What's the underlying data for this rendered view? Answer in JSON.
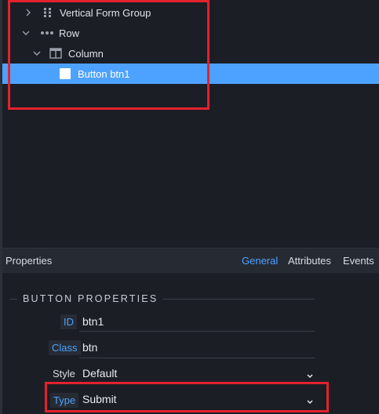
{
  "tree": {
    "items": [
      {
        "label": "Vertical Form Group",
        "icon": "grid-dots-icon",
        "expand": "chevron-right-icon"
      },
      {
        "label": "Row",
        "icon": "horizontal-dots-icon",
        "expand": "chevron-down-icon"
      },
      {
        "label": "Column",
        "icon": "column-layout-icon",
        "expand": "chevron-down-icon"
      },
      {
        "label": "Button btn1",
        "icon": "button-square-icon",
        "selected": true
      }
    ]
  },
  "properties": {
    "title": "Properties",
    "tabs": [
      {
        "label": "General",
        "active": true
      },
      {
        "label": "Attributes",
        "active": false
      },
      {
        "label": "Events",
        "active": false
      }
    ],
    "section_title": "BUTTON PROPERTIES",
    "fields": {
      "id": {
        "label": "ID",
        "value": "btn1"
      },
      "class": {
        "label": "Class",
        "value": "btn"
      },
      "style": {
        "label": "Style",
        "value": "Default"
      },
      "type": {
        "label": "Type",
        "value": "Submit"
      }
    }
  },
  "colors": {
    "accent": "#4ea2ff",
    "highlight_box": "#e3222c",
    "background": "#1b1e25",
    "panel_header": "#262a33"
  }
}
